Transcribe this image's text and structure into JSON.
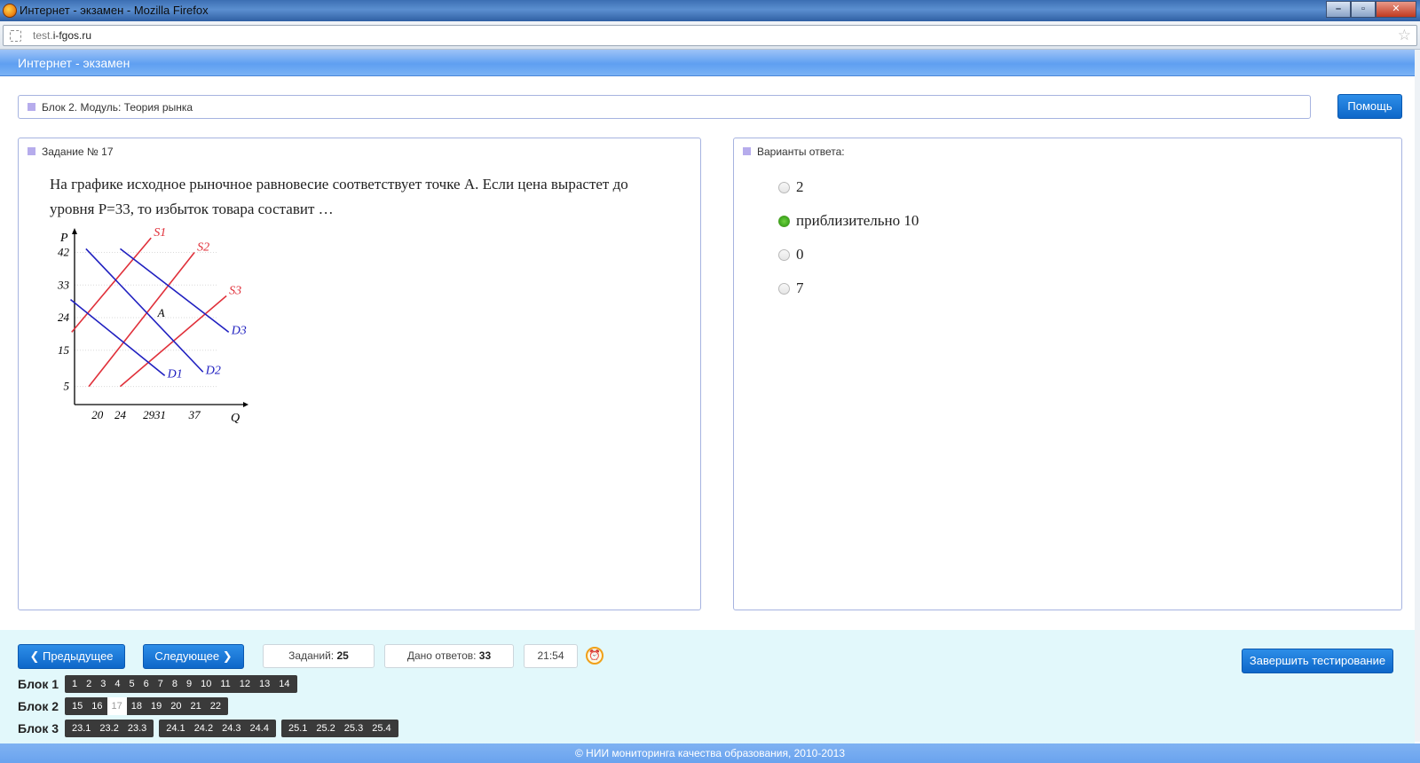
{
  "browser": {
    "window_title": "Интернет - экзамен - Mozilla Firefox",
    "url_prefix": "test.",
    "url_host": "i-fgos.ru",
    "minimize": "–",
    "maximize": "▫",
    "close": "✕"
  },
  "app": {
    "title": "Интернет - экзамен"
  },
  "block_bar": {
    "text": "Блок 2. Модуль: Теория рынка",
    "help_label": "Помощь"
  },
  "task": {
    "header": "Задание № 17",
    "question": "На графике исходное рыночное равновесие соответствует точке А. Если цена вырастет до уровня Р=33, то избыток товара составит …"
  },
  "chart_data": {
    "type": "line",
    "xlabel": "Q",
    "ylabel": "P",
    "x_ticks": [
      20,
      24,
      29,
      31,
      37
    ],
    "y_ticks": [
      5,
      15,
      24,
      33,
      42
    ],
    "point_label": "A",
    "series": [
      {
        "name": "S1",
        "color": "#e0303a",
        "points": [
          [
            15.5,
            20
          ],
          [
            29.4,
            46
          ]
        ]
      },
      {
        "name": "S2",
        "color": "#e0303a",
        "points": [
          [
            18.5,
            5
          ],
          [
            37,
            42
          ]
        ]
      },
      {
        "name": "S3",
        "color": "#e0303a",
        "points": [
          [
            24,
            5
          ],
          [
            42.6,
            30
          ]
        ]
      },
      {
        "name": "D1",
        "color": "#2020c0",
        "points": [
          [
            15.3,
            29
          ],
          [
            31.8,
            8
          ]
        ]
      },
      {
        "name": "D2",
        "color": "#2020c0",
        "points": [
          [
            18,
            43
          ],
          [
            38.5,
            9
          ]
        ]
      },
      {
        "name": "D3",
        "color": "#2020c0",
        "points": [
          [
            24,
            43
          ],
          [
            43,
            20
          ]
        ]
      }
    ],
    "colors": {
      "supply": "#e0303a",
      "demand": "#2020c0"
    }
  },
  "answers": {
    "header": "Варианты ответа:",
    "options": [
      {
        "label": "2",
        "checked": false
      },
      {
        "label": "приблизительно 10",
        "checked": true
      },
      {
        "label": "0",
        "checked": false
      },
      {
        "label": "7",
        "checked": false
      }
    ]
  },
  "nav": {
    "prev_label": "Предыдущее",
    "next_label": "Следующее",
    "tasks_label": "Заданий:",
    "tasks_count": "25",
    "answered_label": "Дано ответов:",
    "answered_count": "33",
    "timer": "21:54",
    "finish_label": "Завершить тестирование",
    "alarm_icon": "alarm-clock-icon"
  },
  "blocks": [
    {
      "name": "Блок 1",
      "groups": [
        [
          "1",
          "2",
          "3",
          "4",
          "5",
          "6",
          "7",
          "8",
          "9",
          "10",
          "11",
          "12",
          "13",
          "14"
        ]
      ]
    },
    {
      "name": "Блок 2",
      "groups": [
        [
          "15",
          "16",
          "17",
          "18",
          "19",
          "20",
          "21",
          "22"
        ]
      ],
      "current": "17"
    },
    {
      "name": "Блок 3",
      "groups": [
        [
          "23.1",
          "23.2",
          "23.3"
        ],
        [
          "24.1",
          "24.2",
          "24.3",
          "24.4"
        ],
        [
          "25.1",
          "25.2",
          "25.3",
          "25.4"
        ]
      ]
    }
  ],
  "footer": {
    "text": "© НИИ мониторинга качества образования, 2010-2013"
  }
}
